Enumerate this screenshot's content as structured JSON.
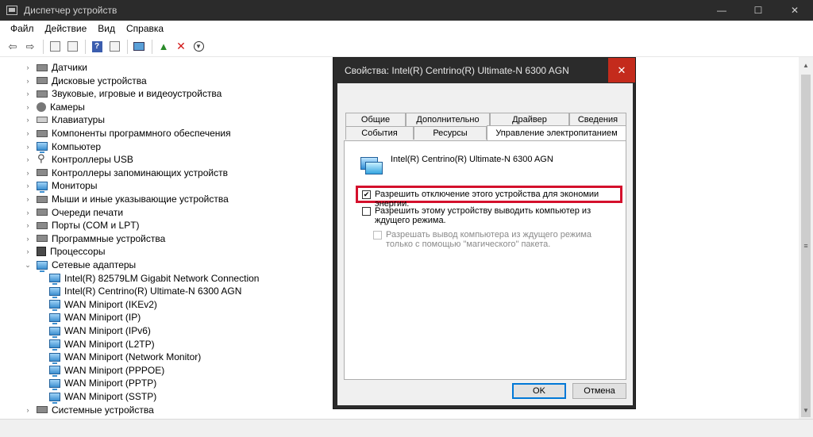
{
  "window": {
    "title": "Диспетчер устройств",
    "controls": [
      "—",
      "☐",
      "✕"
    ]
  },
  "menu": [
    "Файл",
    "Действие",
    "Вид",
    "Справка"
  ],
  "tree": {
    "categories": [
      {
        "label": "Датчики",
        "icon": "sensor-icon",
        "expanded": false
      },
      {
        "label": "Дисковые устройства",
        "icon": "disk-icon",
        "expanded": false
      },
      {
        "label": "Звуковые, игровые и видеоустройства",
        "icon": "speaker-icon",
        "expanded": false
      },
      {
        "label": "Камеры",
        "icon": "camera-icon",
        "expanded": false
      },
      {
        "label": "Клавиатуры",
        "icon": "keyboard-icon",
        "expanded": false
      },
      {
        "label": "Компоненты программного обеспечения",
        "icon": "software-component-icon",
        "expanded": false
      },
      {
        "label": "Компьютер",
        "icon": "computer-icon",
        "expanded": false
      },
      {
        "label": "Контроллеры USB",
        "icon": "usb-icon",
        "expanded": false
      },
      {
        "label": "Контроллеры запоминающих устройств",
        "icon": "storage-controller-icon",
        "expanded": false
      },
      {
        "label": "Мониторы",
        "icon": "monitor-icon",
        "expanded": false
      },
      {
        "label": "Мыши и иные указывающие устройства",
        "icon": "mouse-icon",
        "expanded": false
      },
      {
        "label": "Очереди печати",
        "icon": "printer-icon",
        "expanded": false
      },
      {
        "label": "Порты (COM и LPT)",
        "icon": "port-icon",
        "expanded": false
      },
      {
        "label": "Программные устройства",
        "icon": "software-device-icon",
        "expanded": false
      },
      {
        "label": "Процессоры",
        "icon": "processor-icon",
        "expanded": false
      },
      {
        "label": "Сетевые адаптеры",
        "icon": "network-adapter-icon",
        "expanded": true
      }
    ],
    "network_adapters": [
      "Intel(R) 82579LM Gigabit Network Connection",
      "Intel(R) Centrino(R) Ultimate-N 6300 AGN",
      "WAN Miniport (IKEv2)",
      "WAN Miniport (IP)",
      "WAN Miniport (IPv6)",
      "WAN Miniport (L2TP)",
      "WAN Miniport (Network Monitor)",
      "WAN Miniport (PPPOE)",
      "WAN Miniport (PPTP)",
      "WAN Miniport (SSTP)"
    ],
    "after": {
      "label": "Системные устройства",
      "icon": "system-device-icon",
      "expanded": false
    }
  },
  "dialog": {
    "title": "Свойства: Intel(R) Centrino(R) Ultimate-N 6300 AGN",
    "close": "✕",
    "tabs_row1": [
      "Общие",
      "Дополнительно",
      "Драйвер",
      "Сведения"
    ],
    "tabs_row2": [
      "События",
      "Ресурсы",
      "Управление электропитанием"
    ],
    "active_tab": "Управление электропитанием",
    "device_name": "Intel(R) Centrino(R) Ultimate-N 6300 AGN",
    "options": [
      {
        "label": "Разрешить отключение этого устройства для экономии энергии.",
        "checked": true,
        "enabled": true
      },
      {
        "label": "Разрешить этому устройству выводить компьютер из ждущего режима.",
        "checked": false,
        "enabled": true
      },
      {
        "label": "Разрешать вывод компьютера из ждущего режима только с помощью \"магического\" пакета.",
        "checked": false,
        "enabled": false
      }
    ],
    "ok": "OK",
    "cancel": "Отмена"
  },
  "colors": {
    "titlebar": "#2b2b2b",
    "close_red": "#c42b1c",
    "highlight": "#d4102c",
    "accent": "#0078d7"
  }
}
